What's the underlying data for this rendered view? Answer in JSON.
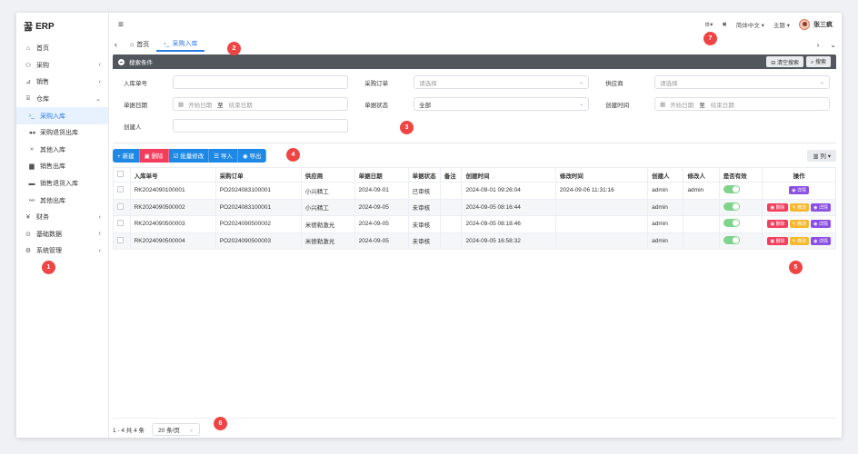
{
  "app": {
    "logo_mark": "꿇",
    "title": "ERP"
  },
  "sidebar": {
    "items": [
      {
        "icon": "⌂",
        "label": "首页",
        "chevron": ""
      },
      {
        "icon": "⚇",
        "label": "采购",
        "chevron": "‹"
      },
      {
        "icon": "⊿",
        "label": "销售",
        "chevron": "‹"
      },
      {
        "icon": "⌸",
        "label": "仓库",
        "chevron": "⌄"
      },
      {
        "icon": "›_",
        "label": "采购入库",
        "chevron": ""
      },
      {
        "icon": "◂◂",
        "label": "采购退货出库",
        "chevron": ""
      },
      {
        "icon": "»",
        "label": "其他入库",
        "chevron": ""
      },
      {
        "icon": "▆",
        "label": "销售出库",
        "chevron": ""
      },
      {
        "icon": "▬",
        "label": "销售退货入库",
        "chevron": ""
      },
      {
        "icon": "⚯",
        "label": "其他出库",
        "chevron": ""
      },
      {
        "icon": "¥",
        "label": "财务",
        "chevron": "‹"
      },
      {
        "icon": "⊙",
        "label": "基础数据",
        "chevron": "‹"
      },
      {
        "icon": "⚙",
        "label": "系统管理",
        "chevron": "‹"
      }
    ]
  },
  "header": {
    "menu_icon": "≡",
    "gear": "⚙▾",
    "fullscreen": "✖",
    "language": "简体中文 ▾",
    "theme": "主题 ▾",
    "username": "张三疯"
  },
  "tabs": [
    {
      "icon": "⌂",
      "label": "首页"
    },
    {
      "icon": "›_",
      "label": "采购入库"
    }
  ],
  "tab_nav": {
    "left": "‹",
    "right": "›",
    "down": "⌄"
  },
  "search": {
    "title": "搜索条件",
    "clear_btn": "⊟ 清空搜索",
    "search_btn": "⌕ 搜索",
    "labels": {
      "inbound_no": "入库单号",
      "po": "采购订单",
      "supplier": "供应商",
      "doc_date": "单据日期",
      "doc_status": "单据状态",
      "created_time": "创建时间",
      "creator": "创建人"
    },
    "select_placeholder": "请选择",
    "start_date": "开始日期",
    "end_date": "结束日期",
    "date_sep": "至",
    "status_value": "全部",
    "calendar_icon": "▦"
  },
  "toolbar": {
    "new": "+ 新建",
    "delete": "▣ 删除",
    "batch": "☑ 批量修改",
    "import": "☰ 导入",
    "export": "◉ 导出",
    "columns": "▥ 列 ▾"
  },
  "table": {
    "headers": [
      "入库单号",
      "采购订单",
      "供应商",
      "单据日期",
      "单据状态",
      "备注",
      "创建时间",
      "修改时间",
      "创建人",
      "修改人",
      "是否有效",
      "操作"
    ],
    "rows": [
      {
        "no": "RK2024090100001",
        "po": "PO2024083100001",
        "supplier": "小兴精工",
        "date": "2024-09-01",
        "status": "已审核",
        "remark": "",
        "created": "2024-09-01 09:26:04",
        "modified": "2024-09-06 11:31:16",
        "creator": "admin",
        "modifier": "admin"
      },
      {
        "no": "RK2024090500002",
        "po": "PO2024083100001",
        "supplier": "小兴精工",
        "date": "2024-09-05",
        "status": "未审核",
        "remark": "",
        "created": "2024-09-05 08:16:44",
        "modified": "",
        "creator": "admin",
        "modifier": ""
      },
      {
        "no": "RK2024090500003",
        "po": "PO2024090500002",
        "supplier": "米德勒激光",
        "date": "2024-09-05",
        "status": "未审核",
        "remark": "",
        "created": "2024-09-05 08:18:46",
        "modified": "",
        "creator": "admin",
        "modifier": ""
      },
      {
        "no": "RK2024090500004",
        "po": "PO2024090500003",
        "supplier": "米德勒激光",
        "date": "2024-09-05",
        "status": "未审核",
        "remark": "",
        "created": "2024-09-05 16:58:32",
        "modified": "",
        "creator": "admin",
        "modifier": ""
      }
    ],
    "op_delete": "▣ 删除",
    "op_edit": "✎ 修改",
    "op_detail": "◉ 详情"
  },
  "pagination": {
    "summary": "1 - 4 共 4 条",
    "page_size": "20 条/页",
    "arrow": "⌄"
  },
  "badges": [
    "1",
    "2",
    "3",
    "4",
    "5",
    "6",
    "7"
  ]
}
